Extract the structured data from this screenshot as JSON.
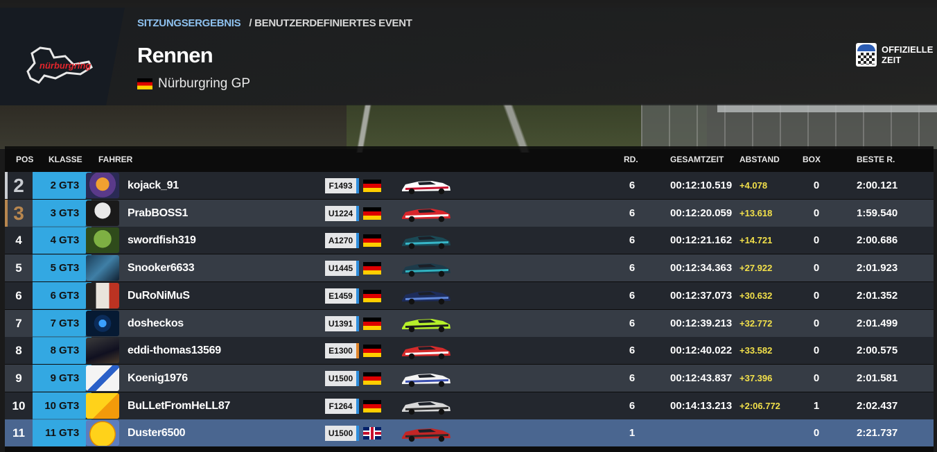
{
  "header": {
    "breadcrumb_active": "SITZUNGSERGEBNIS",
    "breadcrumb_rest": "/ BENUTZERDEFINIERTES EVENT",
    "title": "Rennen",
    "track": "Nürburgring GP",
    "logo_text": "nürburgring",
    "official_line1": "OFFIZIELLE",
    "official_line2": "ZEIT"
  },
  "columns": {
    "pos": "POS",
    "klasse": "KLASSE",
    "fahrer": "FAHRER",
    "rd": "RD.",
    "gesamtzeit": "GESAMTZEIT",
    "abstand": "ABSTAND",
    "box": "BOX",
    "beste": "BESTE R."
  },
  "rows": [
    {
      "pos": "2",
      "class_pos": "2",
      "class": "GT3",
      "name": "kojack_91",
      "license": "F1493",
      "flag": "de",
      "rounds": "6",
      "total": "00:12:10.519",
      "gap": "+4.078",
      "box": "0",
      "best": "2:00.121"
    },
    {
      "pos": "3",
      "class_pos": "3",
      "class": "GT3",
      "name": "PrabBOSS1",
      "license": "U1224",
      "flag": "de",
      "rounds": "6",
      "total": "00:12:20.059",
      "gap": "+13.618",
      "box": "0",
      "best": "1:59.540"
    },
    {
      "pos": "4",
      "class_pos": "4",
      "class": "GT3",
      "name": "swordfish319",
      "license": "A1270",
      "flag": "de",
      "rounds": "6",
      "total": "00:12:21.162",
      "gap": "+14.721",
      "box": "0",
      "best": "2:00.686"
    },
    {
      "pos": "5",
      "class_pos": "5",
      "class": "GT3",
      "name": "Snooker6633",
      "license": "U1445",
      "flag": "de",
      "rounds": "6",
      "total": "00:12:34.363",
      "gap": "+27.922",
      "box": "0",
      "best": "2:01.923"
    },
    {
      "pos": "6",
      "class_pos": "6",
      "class": "GT3",
      "name": "DuRoNiMuS",
      "license": "E1459",
      "flag": "de",
      "rounds": "6",
      "total": "00:12:37.073",
      "gap": "+30.632",
      "box": "0",
      "best": "2:01.352"
    },
    {
      "pos": "7",
      "class_pos": "7",
      "class": "GT3",
      "name": "dosheckos",
      "license": "U1391",
      "flag": "de",
      "rounds": "6",
      "total": "00:12:39.213",
      "gap": "+32.772",
      "box": "0",
      "best": "2:01.499"
    },
    {
      "pos": "8",
      "class_pos": "8",
      "class": "GT3",
      "name": "eddi-thomas13569",
      "license": "E1300",
      "flag": "de",
      "rounds": "6",
      "total": "00:12:40.022",
      "gap": "+33.582",
      "box": "0",
      "best": "2:00.575"
    },
    {
      "pos": "9",
      "class_pos": "9",
      "class": "GT3",
      "name": "Koenig1976",
      "license": "U1500",
      "flag": "de",
      "rounds": "6",
      "total": "00:12:43.837",
      "gap": "+37.396",
      "box": "0",
      "best": "2:01.581"
    },
    {
      "pos": "10",
      "class_pos": "10",
      "class": "GT3",
      "name": "BuLLetFromHeLL87",
      "license": "F1264",
      "flag": "de",
      "rounds": "6",
      "total": "00:14:13.213",
      "gap": "+2:06.772",
      "box": "1",
      "best": "2:02.437"
    },
    {
      "pos": "11",
      "class_pos": "11",
      "class": "GT3",
      "name": "Duster6500",
      "license": "U1500",
      "flag": "uk",
      "rounds": "1",
      "total": "",
      "gap": "",
      "box": "0",
      "best": "2:21.737"
    }
  ],
  "colors": {
    "class_badge": "#33a8e2",
    "gap_text": "#f2e04a",
    "highlight_row": "#4a6690",
    "silver": "#c9ccd1",
    "bronze": "#b8874f"
  }
}
